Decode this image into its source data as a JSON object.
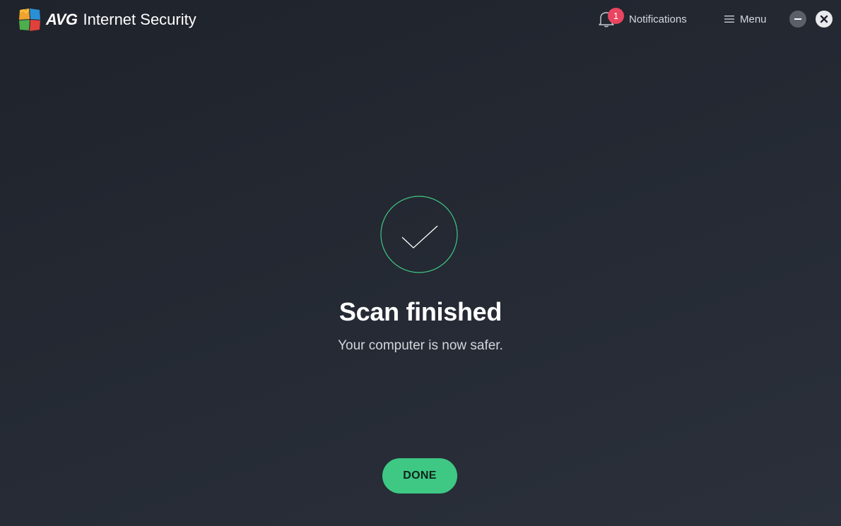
{
  "app": {
    "brand": "AVG",
    "product": "Internet Security"
  },
  "header": {
    "notifications_label": "Notifications",
    "notifications_count": "1",
    "menu_label": "Menu"
  },
  "main": {
    "title": "Scan finished",
    "subtitle": "Your computer is now safer.",
    "done_label": "DONE"
  },
  "icons": {
    "logo": "avg-logo-icon",
    "notifications": "bell-icon",
    "menu": "hamburger-icon",
    "minimize": "minimize-icon",
    "close": "close-icon",
    "status": "checkmark-icon"
  },
  "colors": {
    "accent": "#3ec884",
    "badge": "#e94560",
    "background": "#23272f"
  }
}
